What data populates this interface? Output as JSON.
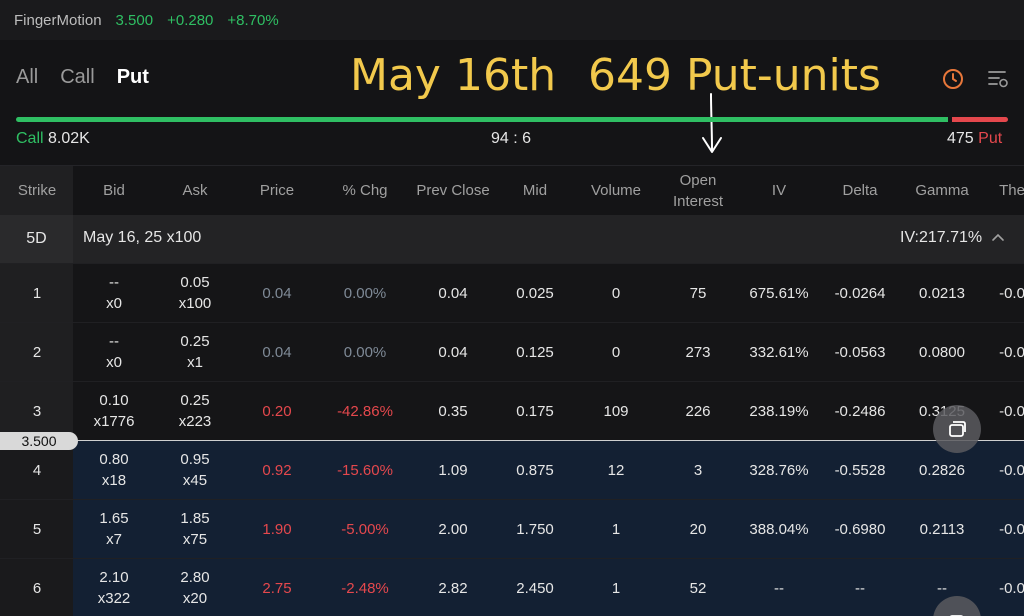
{
  "ticker": {
    "name": "FingerMotion",
    "price": "3.500",
    "change": "+0.280",
    "change_pct": "+8.70%"
  },
  "tabs": [
    {
      "label": "All"
    },
    {
      "label": "Call"
    },
    {
      "label": "Put"
    }
  ],
  "overlay": {
    "date_text": "May 16th",
    "units_text": "649 Put-units"
  },
  "icons": {
    "clock": "clock-icon",
    "filter": "filter-settings-icon"
  },
  "summary": {
    "call_label": "Call",
    "call_volume": "8.02K",
    "ratio": "94 : 6",
    "put_volume": "475",
    "put_label": "Put",
    "call_share": 0.94
  },
  "columns": [
    {
      "label": "Strike"
    },
    {
      "label": "Bid"
    },
    {
      "label": "Ask"
    },
    {
      "label": "Price"
    },
    {
      "label": "% Chg"
    },
    {
      "label": "Prev Close"
    },
    {
      "label": "Mid"
    },
    {
      "label": "Volume"
    },
    {
      "label": "Open\nInterest"
    },
    {
      "label": "IV"
    },
    {
      "label": "Delta"
    },
    {
      "label": "Gamma"
    },
    {
      "label": "The"
    }
  ],
  "group": {
    "dte": "5D",
    "expiry": "May 16, 25  x100",
    "iv": "IV:217.71%"
  },
  "price_marker": "3.500",
  "rows": [
    {
      "strike": "1",
      "bid": "--",
      "bid_size": "x0",
      "ask": "0.05",
      "ask_size": "x100",
      "price": "0.04",
      "chg": "0.00%",
      "prev": "0.04",
      "mid": "0.025",
      "vol": "0",
      "oi": "75",
      "iv": "675.61%",
      "delta": "-0.0264",
      "gamma": "0.0213",
      "theta": "-0.0"
    },
    {
      "strike": "2",
      "bid": "--",
      "bid_size": "x0",
      "ask": "0.25",
      "ask_size": "x1",
      "price": "0.04",
      "chg": "0.00%",
      "prev": "0.04",
      "mid": "0.125",
      "vol": "0",
      "oi": "273",
      "iv": "332.61%",
      "delta": "-0.0563",
      "gamma": "0.0800",
      "theta": "-0.0"
    },
    {
      "strike": "3",
      "bid": "0.10",
      "bid_size": "x1776",
      "ask": "0.25",
      "ask_size": "x223",
      "price": "0.20",
      "chg": "-42.86%",
      "prev": "0.35",
      "mid": "0.175",
      "vol": "109",
      "oi": "226",
      "iv": "238.19%",
      "delta": "-0.2486",
      "gamma": "0.3125",
      "theta": "-0.0"
    },
    {
      "strike": "4",
      "bid": "0.80",
      "bid_size": "x18",
      "ask": "0.95",
      "ask_size": "x45",
      "price": "0.92",
      "chg": "-15.60%",
      "prev": "1.09",
      "mid": "0.875",
      "vol": "12",
      "oi": "3",
      "iv": "328.76%",
      "delta": "-0.5528",
      "gamma": "0.2826",
      "theta": "-0.0"
    },
    {
      "strike": "5",
      "bid": "1.65",
      "bid_size": "x7",
      "ask": "1.85",
      "ask_size": "x75",
      "price": "1.90",
      "chg": "-5.00%",
      "prev": "2.00",
      "mid": "1.750",
      "vol": "1",
      "oi": "20",
      "iv": "388.04%",
      "delta": "-0.6980",
      "gamma": "0.2113",
      "theta": "-0.0"
    },
    {
      "strike": "6",
      "bid": "2.10",
      "bid_size": "x322",
      "ask": "2.80",
      "ask_size": "x20",
      "price": "2.75",
      "chg": "-2.48%",
      "prev": "2.82",
      "mid": "2.450",
      "vol": "1",
      "oi": "52",
      "iv": "--",
      "delta": "--",
      "gamma": "--",
      "theta": "-0.0"
    }
  ],
  "colors": {
    "up": "#2fbf63",
    "down": "#e5484d",
    "accent": "#f2c94c",
    "itm_bg": "#132033"
  }
}
